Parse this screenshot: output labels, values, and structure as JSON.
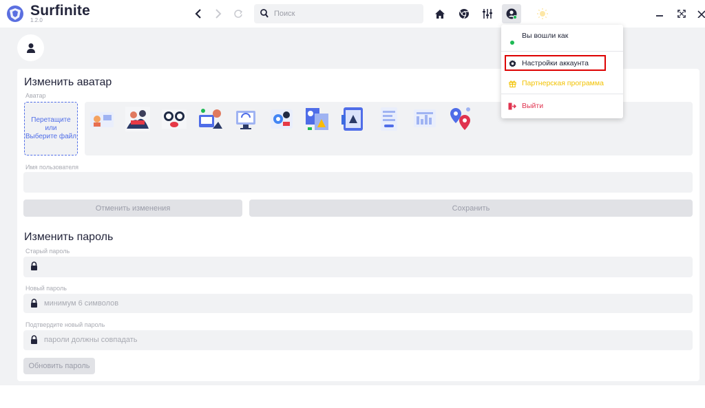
{
  "app": {
    "name": "Surfinite",
    "version": "1.2.0"
  },
  "toolbar": {
    "search_placeholder": "Поиск",
    "icons": [
      "back-icon",
      "forward-icon",
      "reload-icon",
      "home-icon",
      "chrome-icon",
      "sliders-icon",
      "account-icon",
      "theme-sun-icon"
    ]
  },
  "window_controls": [
    "minimize-icon",
    "maximize-icon",
    "close-icon"
  ],
  "avatar_section": {
    "title": "Изменить аватар",
    "label": "Аватар",
    "dropzone": {
      "line1": "Перетащите",
      "line2": "или",
      "line3": "Выберите файл"
    },
    "presets_count": 11
  },
  "username": {
    "label": "Имя пользователя",
    "value": ""
  },
  "profile_buttons": {
    "cancel": "Отменить изменения",
    "save": "Сохранить"
  },
  "password_section": {
    "title": "Изменить пароль",
    "old": {
      "label": "Старый пароль",
      "placeholder": ""
    },
    "new": {
      "label": "Новый пароль",
      "placeholder": "минимум 6 символов"
    },
    "confirm": {
      "label": "Подтвердите новый пароль",
      "placeholder": "пароли должны совпадать"
    },
    "submit": "Обновить пароль"
  },
  "account_menu": {
    "logged_in_as": "Вы вошли как",
    "items": [
      {
        "label": "Настройки аккаунта",
        "icon": "gear-icon",
        "color": "#1e2235"
      },
      {
        "label": "Партнерская программа",
        "icon": "gift-icon",
        "color": "#f2c200"
      },
      {
        "label": "Выйти",
        "icon": "logout-icon",
        "color": "#e0334f"
      }
    ]
  },
  "colors": {
    "accent": "#4f6de8",
    "online": "#1db954",
    "highlight": "#dd0000"
  }
}
